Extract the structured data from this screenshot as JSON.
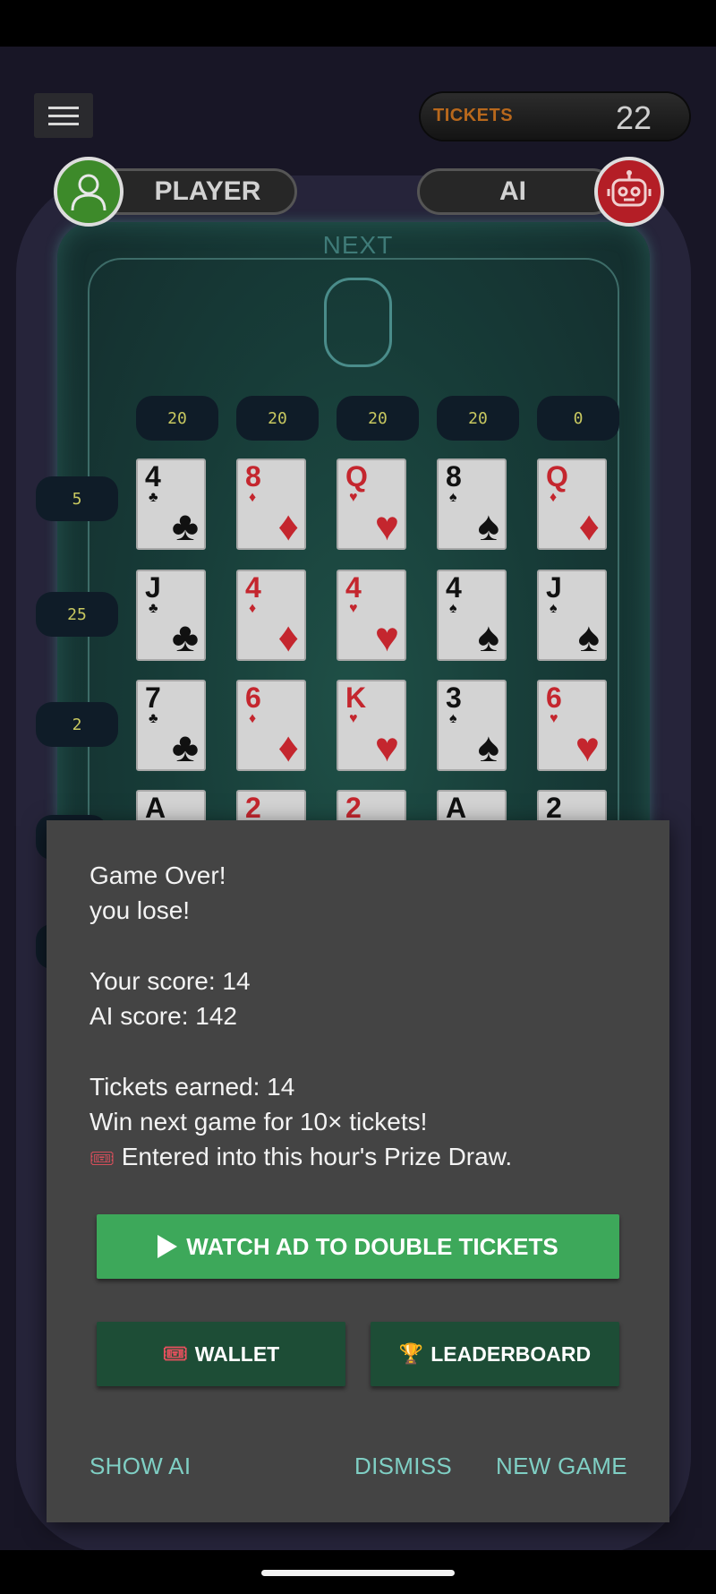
{
  "header": {
    "tickets_label": "TICKETS",
    "tickets_count": "22"
  },
  "players": {
    "player_name": "PLAYER",
    "ai_name": "AI"
  },
  "board": {
    "next_label": "NEXT",
    "column_scores": [
      "20",
      "20",
      "20",
      "20",
      "0"
    ],
    "row_scores": [
      "5",
      "25",
      "2"
    ],
    "rows": [
      [
        {
          "rank": "4",
          "suit": "♣",
          "color": "black"
        },
        {
          "rank": "8",
          "suit": "♦",
          "color": "red"
        },
        {
          "rank": "Q",
          "suit": "♥",
          "color": "red"
        },
        {
          "rank": "8",
          "suit": "♠",
          "color": "black"
        },
        {
          "rank": "Q",
          "suit": "♦",
          "color": "red"
        }
      ],
      [
        {
          "rank": "J",
          "suit": "♣",
          "color": "black"
        },
        {
          "rank": "4",
          "suit": "♦",
          "color": "red"
        },
        {
          "rank": "4",
          "suit": "♥",
          "color": "red"
        },
        {
          "rank": "4",
          "suit": "♠",
          "color": "black"
        },
        {
          "rank": "J",
          "suit": "♠",
          "color": "black"
        }
      ],
      [
        {
          "rank": "7",
          "suit": "♣",
          "color": "black"
        },
        {
          "rank": "6",
          "suit": "♦",
          "color": "red"
        },
        {
          "rank": "K",
          "suit": "♥",
          "color": "red"
        },
        {
          "rank": "3",
          "suit": "♠",
          "color": "black"
        },
        {
          "rank": "6",
          "suit": "♥",
          "color": "red"
        }
      ],
      [
        {
          "rank": "A",
          "suit": "",
          "color": "black"
        },
        {
          "rank": "2",
          "suit": "",
          "color": "red"
        },
        {
          "rank": "2",
          "suit": "",
          "color": "red"
        },
        {
          "rank": "A",
          "suit": "",
          "color": "black"
        },
        {
          "rank": "2",
          "suit": "",
          "color": "black"
        }
      ]
    ]
  },
  "dialog": {
    "line_game_over": "Game Over!",
    "line_result": "you lose!",
    "line_your_score": "Your score: 14",
    "line_ai_score": "AI score: 142",
    "line_tickets_earned": "Tickets earned: 14",
    "line_next_game": "Win next game for 10× tickets!",
    "ticket_emoji": "🎟",
    "line_prize_draw": "Entered into this hour's Prize Draw.",
    "watch_ad_label": "WATCH AD TO DOUBLE TICKETS",
    "wallet_label": "WALLET",
    "trophy_emoji": "🏆",
    "leaderboard_label": "LEADERBOARD",
    "show_ai_label": "SHOW AI",
    "dismiss_label": "DISMISS",
    "new_game_label": "NEW GAME"
  }
}
